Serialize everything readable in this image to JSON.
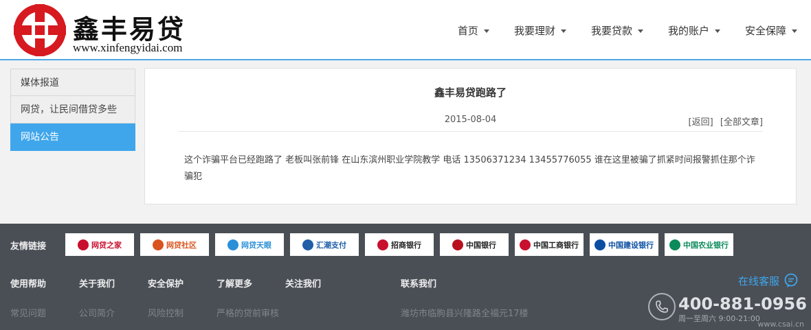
{
  "header": {
    "logo_title": "鑫丰易贷",
    "logo_url": "www.xinfengyidai.com",
    "nav": [
      {
        "label": "首页"
      },
      {
        "label": "我要理财"
      },
      {
        "label": "我要贷款"
      },
      {
        "label": "我的账户"
      },
      {
        "label": "安全保障"
      }
    ]
  },
  "sidebar": {
    "items": [
      {
        "label": "媒体报道"
      },
      {
        "label": "网贷，让民间借贷多些"
      },
      {
        "label": "网站公告"
      }
    ],
    "active_index": 2
  },
  "article": {
    "title": "鑫丰易贷跑路了",
    "date": "2015-08-04",
    "back_link": "[返回]",
    "all_link": "[全部文章]",
    "body": "这个诈骗平台已经跑路了  老板叫张前锋  在山东滨州职业学院教学  电话  13506371234  13455776055   谁在这里被骗了抓紧时间报警抓住那个诈骗犯"
  },
  "footer": {
    "friend_label": "友情链接",
    "friend_links": [
      {
        "label": "网贷之家",
        "color": "#c8102e"
      },
      {
        "label": "网贷社区",
        "color": "#d9531e"
      },
      {
        "label": "网贷天眼",
        "color": "#2a8fd8"
      },
      {
        "label": "汇潮支付",
        "color": "#1f5fa8"
      },
      {
        "label": "招商银行",
        "color": "#c8102e"
      },
      {
        "label": "中国银行",
        "color": "#b8101f"
      },
      {
        "label": "中国工商银行",
        "color": "#c8102e"
      },
      {
        "label": "中国建设银行",
        "color": "#0a4ea2"
      },
      {
        "label": "中国农业银行",
        "color": "#0b8a5a"
      }
    ],
    "columns": [
      {
        "heading": "使用帮助",
        "item": "常见问题"
      },
      {
        "heading": "关于我们",
        "item": "公司简介"
      },
      {
        "heading": "安全保护",
        "item": "风险控制"
      },
      {
        "heading": "了解更多",
        "item": "严格的贷前审核"
      },
      {
        "heading": "关注我们",
        "item": ""
      }
    ],
    "contact": {
      "heading": "联系我们",
      "address": "潍坊市临朐县兴隆路全福元17楼"
    },
    "online_service": "在线客服",
    "phone": "400-881-0956",
    "hours": "周一至周六 9:00-21:00",
    "watermark": "www.csai.cn"
  },
  "colors": {
    "accent": "#3fa6ec",
    "logo_red": "#d71920",
    "footer_bg": "#4a4f56"
  }
}
